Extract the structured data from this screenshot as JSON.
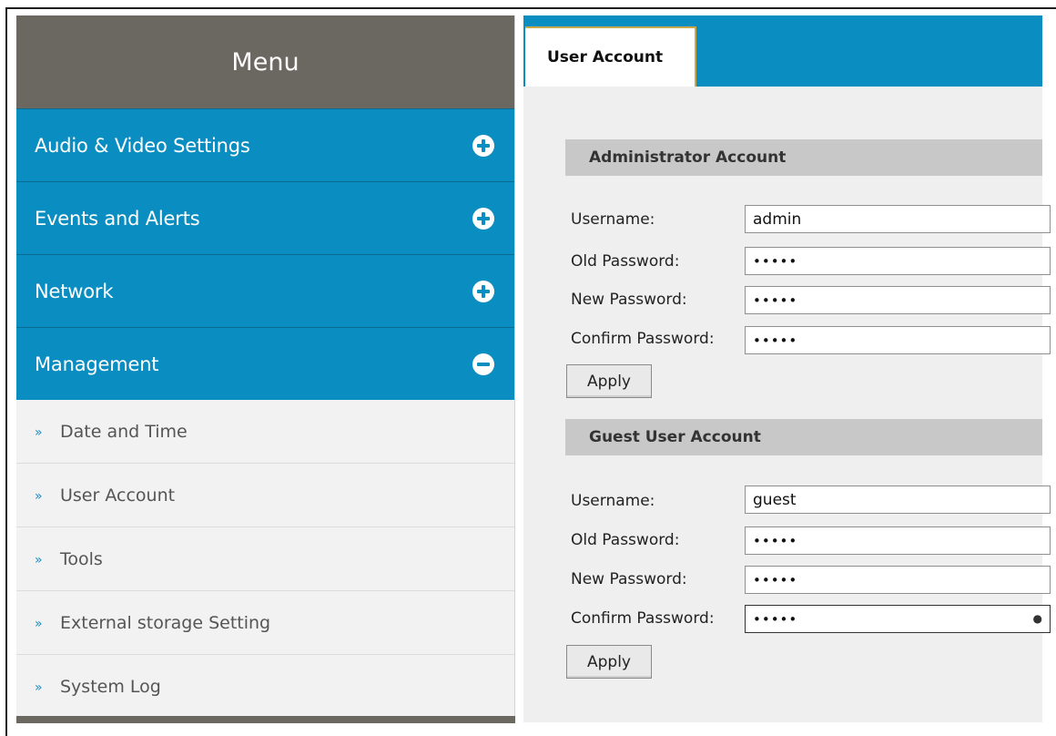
{
  "menu": {
    "title": "Menu",
    "groups": [
      {
        "label": "Audio & Video Settings",
        "icon": "plus-circle-icon"
      },
      {
        "label": "Events and Alerts",
        "icon": "plus-circle-icon"
      },
      {
        "label": "Network",
        "icon": "plus-circle-icon"
      },
      {
        "label": "Management",
        "icon": "minus-circle-icon"
      }
    ],
    "sub_items": [
      {
        "label": "Date and Time"
      },
      {
        "label": "User Account"
      },
      {
        "label": "Tools"
      },
      {
        "label": "External storage Setting"
      },
      {
        "label": "System Log"
      }
    ],
    "chevron": "»"
  },
  "content": {
    "active_tab": "User Account",
    "admin": {
      "title": "Administrator Account",
      "username_label": "Username:",
      "username_value": "admin",
      "old_password_label": "Old Password:",
      "old_password_value": "•••••",
      "new_password_label": "New Password:",
      "new_password_value": "•••••",
      "confirm_password_label": "Confirm Password:",
      "confirm_password_value": "•••••",
      "apply_label": "Apply"
    },
    "guest": {
      "title": "Guest User Account",
      "username_label": "Username:",
      "username_value": "guest",
      "old_password_label": "Old Password:",
      "old_password_value": "•••••",
      "new_password_label": "New Password:",
      "new_password_value": "•••••",
      "confirm_password_label": "Confirm Password:",
      "confirm_password_value": "•••••",
      "apply_label": "Apply"
    }
  },
  "colors": {
    "accent_blue": "#0a8dc0",
    "menu_header": "#6b6761",
    "panel_bg": "#efefef"
  }
}
